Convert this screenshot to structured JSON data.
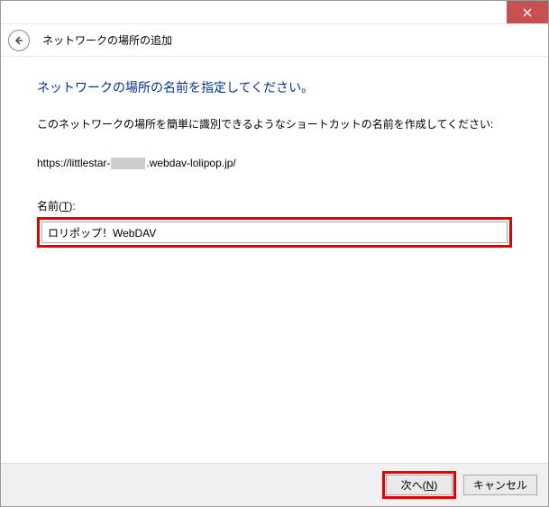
{
  "titlebar": {
    "close_icon": "close"
  },
  "header": {
    "title": "ネットワークの場所の追加"
  },
  "content": {
    "heading": "ネットワークの場所の名前を指定してください。",
    "instruction": "このネットワークの場所を簡単に識別できるようなショートカットの名前を作成してください:",
    "url_prefix": "https://littlestar-",
    "url_suffix": ".webdav-lolipop.jp/",
    "name_label": "名前(T):",
    "name_label_pre": "名前(",
    "name_label_hotkey": "T",
    "name_label_post": "):",
    "name_value": "ロリポップ！WebDAV"
  },
  "footer": {
    "next_pre": "次へ(",
    "next_hotkey": "N",
    "next_post": ")",
    "cancel": "キャンセル"
  }
}
